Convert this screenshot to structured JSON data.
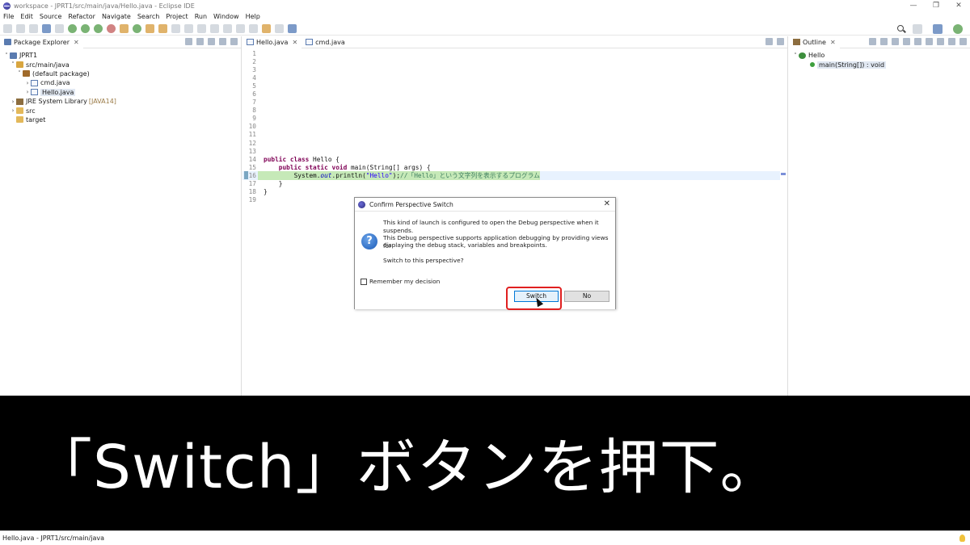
{
  "window": {
    "title": "workspace - JPRT1/src/main/java/Hello.java - Eclipse IDE",
    "controls": {
      "minimize": "—",
      "restore": "❐",
      "close": "✕"
    }
  },
  "menu": [
    "File",
    "Edit",
    "Source",
    "Refactor",
    "Navigate",
    "Search",
    "Project",
    "Run",
    "Window",
    "Help"
  ],
  "package_explorer": {
    "tab_label": "Package Explorer",
    "tree": {
      "project": "JPRT1",
      "src_main_java": "src/main/java",
      "default_package": "(default package)",
      "file_cmd": "cmd.java",
      "file_hello": "Hello.java",
      "jre": "JRE System Library",
      "jre_version": "[JAVA14]",
      "src": "src",
      "target": "target"
    }
  },
  "editor": {
    "tabs": [
      "Hello.java",
      "cmd.java"
    ],
    "line_numbers": [
      "1",
      "2",
      "3",
      "4",
      "5",
      "6",
      "7",
      "8",
      "9",
      "10",
      "11",
      "12",
      "13",
      "14",
      "15",
      "16",
      "17",
      "18",
      "19"
    ],
    "code": {
      "l14_kw": "public class",
      "l14_rest": " Hello {",
      "l15_kw": "public static void",
      "l15_rest": " main(String[] args) {",
      "l16_a": "System.",
      "l16_fld": "out",
      "l16_b": ".println(",
      "l16_str": "\"Hello\"",
      "l16_c": ");",
      "l16_cmt": "//「Hello」という文字列を表示するプログラム",
      "l17": "}",
      "l18": "}"
    }
  },
  "outline": {
    "tab_label": "Outline",
    "class_name": "Hello",
    "method": "main(String[]) : void"
  },
  "dialog": {
    "title": "Confirm Perspective Switch",
    "message_1": "This kind of launch is configured to open the Debug perspective when it suspends.",
    "message_2a": "This Debug perspective supports application debugging by providing views for",
    "message_2b": "displaying the debug stack, variables and breakpoints.",
    "message_3": "Switch to this perspective?",
    "remember_label": "Remember my decision",
    "switch_label": "Switch",
    "no_label": "No",
    "close_glyph": "✕",
    "question_glyph": "?"
  },
  "status_bar": {
    "text": "Hello.java - JPRT1/src/main/java"
  },
  "caption": "「Switch」ボタンを押下。"
}
